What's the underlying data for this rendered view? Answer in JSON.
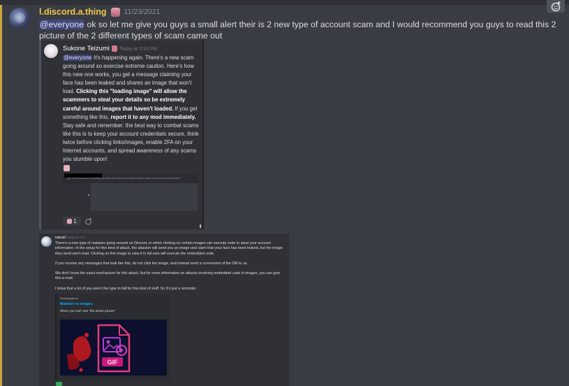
{
  "message": {
    "username": "l.discord.a.thing",
    "timestamp": "11/23/2021",
    "mention": "@everyone",
    "text": " ok so let me give you guys a small alert their is 2 new type of account scam and I would recommend you guys to read this 2 picture of the 2 different types of scam came out"
  },
  "embed1": {
    "author": "Sukone Teizumi",
    "time": "Today at 3:53 PM",
    "mention": "@everyone",
    "p1": " It's happening again.  There's a new scam going around so exercise extreme caution.  Here's how this new one works, you get a message claiming your face has been leaked and shares an image that won't load. ",
    "bold1": "Clicking this \"loading image\" will allow the scammers to steal your details so be extremely careful around images that haven't loaded.",
    "p2": "  If you get something like this, ",
    "bold2": "report it to any mod immediately.",
    "p3": "  Stay safe and remember: the best way to combat scams like this is to keep your account credentials secure, think twice before clicking links/images, enable 2FA on your Internet accounts, and spread awareness of any scams you stumble upon!",
    "image_text": "jpg / Hello someone is stealing your face and claims it is verified please check it out is it this actually you?",
    "reaction_count": "1"
  },
  "embed2": {
    "author": "rascal",
    "time": "Today at 4:17",
    "para1": "There's a new type of malware going around on Discord, in which clicking on certain images can execute code to steal your account information. In the setup for this kind of attack, the attacker will send you an image and claim that your face has been leaked, but the image they send won't load. Clicking on this image to view it in full-size will execute the embedded code.",
    "para2": "If you receive any messages that look like this, do not click the image, and instead send a screenshot of the DM to us.",
    "para3": "We don't know the exact mechanism for this attack, but for more information on attacks involving embedded code in images, you can give this a read.",
    "para4": "I know that a lot of you aren't the type to fall for this kind of stuff. So it's just a reminder.",
    "card_provider": "Reverasingtools",
    "card_title": "Malware in images",
    "card_desc": "When you can't see \"the whole picture\"",
    "card_image_label": "GIF"
  },
  "icons": {
    "add_reaction": "add-reaction-icon"
  }
}
